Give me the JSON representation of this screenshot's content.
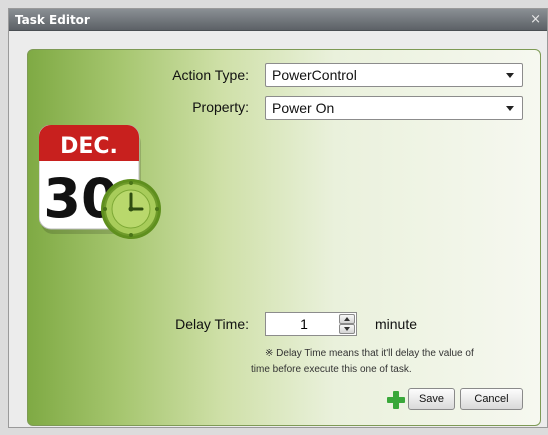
{
  "window": {
    "title": "Task Editor",
    "close_glyph": "×"
  },
  "form": {
    "action_type_label": "Action Type:",
    "action_type_value": "PowerControl",
    "property_label": "Property:",
    "property_value": "Power On",
    "delay_label": "Delay Time:",
    "delay_value": "1",
    "delay_unit": "minute",
    "note_line1": "※ Delay Time means  that it'll delay the value of",
    "note_line2": "time before execute this one of task."
  },
  "calendar_icon": {
    "month": "DEC.",
    "day": "30"
  },
  "buttons": {
    "save": "Save",
    "cancel": "Cancel"
  },
  "colors": {
    "calendar_red": "#c8201e",
    "clock_green": "#8ab43a",
    "add_green": "#3aa83a"
  }
}
